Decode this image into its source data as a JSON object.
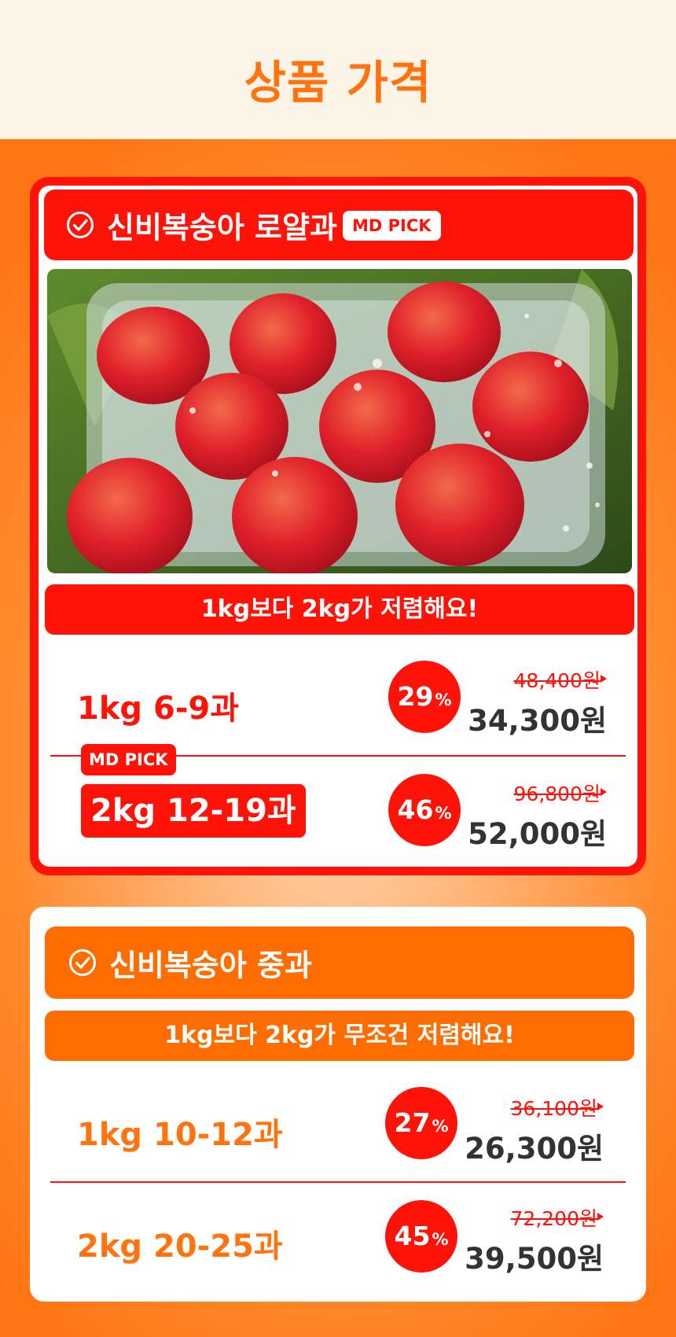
{
  "page": {
    "title": "상품 가격"
  },
  "colors": {
    "accent_red": "#ff1208",
    "accent_orange": "#ff6c00",
    "title_orange": "#ff7410",
    "header_bg": "#fdf4e8"
  },
  "royal": {
    "title": "신비복숭아 로얄과",
    "badge": "MD PICK",
    "notice": "1kg보다 2kg가 저렴해요!",
    "options": [
      {
        "label": "1kg 6-9과",
        "discount": "29",
        "percent_sign": "%",
        "original_price": "48,400원",
        "price": "34,300원"
      },
      {
        "label": "2kg 12-19과",
        "tag": "MD PICK",
        "discount": "46",
        "percent_sign": "%",
        "original_price": "96,800원",
        "price": "52,000원"
      }
    ]
  },
  "medium": {
    "title": "신비복숭아 중과",
    "notice": "1kg보다 2kg가 무조건 저렴해요!",
    "options": [
      {
        "label": "1kg 10-12과",
        "discount": "27",
        "percent_sign": "%",
        "original_price": "36,100원",
        "price": "26,300원"
      },
      {
        "label": "2kg 20-25과",
        "discount": "45",
        "percent_sign": "%",
        "original_price": "72,200원",
        "price": "39,500원"
      }
    ]
  },
  "icons": {
    "check": "check-circle-icon"
  }
}
